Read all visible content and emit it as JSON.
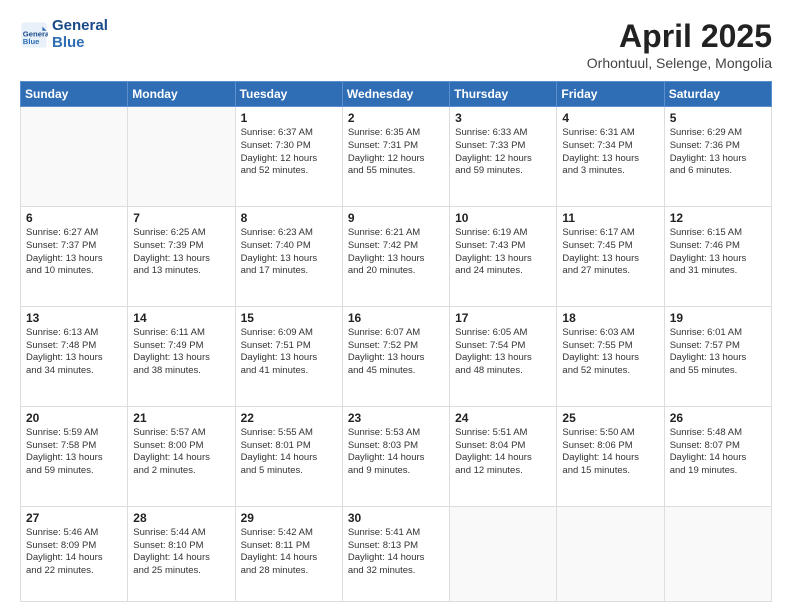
{
  "header": {
    "logo_line1": "General",
    "logo_line2": "Blue",
    "month": "April 2025",
    "location": "Orhontuul, Selenge, Mongolia"
  },
  "weekdays": [
    "Sunday",
    "Monday",
    "Tuesday",
    "Wednesday",
    "Thursday",
    "Friday",
    "Saturday"
  ],
  "weeks": [
    [
      {
        "day": "",
        "info": ""
      },
      {
        "day": "",
        "info": ""
      },
      {
        "day": "1",
        "info": "Sunrise: 6:37 AM\nSunset: 7:30 PM\nDaylight: 12 hours\nand 52 minutes."
      },
      {
        "day": "2",
        "info": "Sunrise: 6:35 AM\nSunset: 7:31 PM\nDaylight: 12 hours\nand 55 minutes."
      },
      {
        "day": "3",
        "info": "Sunrise: 6:33 AM\nSunset: 7:33 PM\nDaylight: 12 hours\nand 59 minutes."
      },
      {
        "day": "4",
        "info": "Sunrise: 6:31 AM\nSunset: 7:34 PM\nDaylight: 13 hours\nand 3 minutes."
      },
      {
        "day": "5",
        "info": "Sunrise: 6:29 AM\nSunset: 7:36 PM\nDaylight: 13 hours\nand 6 minutes."
      }
    ],
    [
      {
        "day": "6",
        "info": "Sunrise: 6:27 AM\nSunset: 7:37 PM\nDaylight: 13 hours\nand 10 minutes."
      },
      {
        "day": "7",
        "info": "Sunrise: 6:25 AM\nSunset: 7:39 PM\nDaylight: 13 hours\nand 13 minutes."
      },
      {
        "day": "8",
        "info": "Sunrise: 6:23 AM\nSunset: 7:40 PM\nDaylight: 13 hours\nand 17 minutes."
      },
      {
        "day": "9",
        "info": "Sunrise: 6:21 AM\nSunset: 7:42 PM\nDaylight: 13 hours\nand 20 minutes."
      },
      {
        "day": "10",
        "info": "Sunrise: 6:19 AM\nSunset: 7:43 PM\nDaylight: 13 hours\nand 24 minutes."
      },
      {
        "day": "11",
        "info": "Sunrise: 6:17 AM\nSunset: 7:45 PM\nDaylight: 13 hours\nand 27 minutes."
      },
      {
        "day": "12",
        "info": "Sunrise: 6:15 AM\nSunset: 7:46 PM\nDaylight: 13 hours\nand 31 minutes."
      }
    ],
    [
      {
        "day": "13",
        "info": "Sunrise: 6:13 AM\nSunset: 7:48 PM\nDaylight: 13 hours\nand 34 minutes."
      },
      {
        "day": "14",
        "info": "Sunrise: 6:11 AM\nSunset: 7:49 PM\nDaylight: 13 hours\nand 38 minutes."
      },
      {
        "day": "15",
        "info": "Sunrise: 6:09 AM\nSunset: 7:51 PM\nDaylight: 13 hours\nand 41 minutes."
      },
      {
        "day": "16",
        "info": "Sunrise: 6:07 AM\nSunset: 7:52 PM\nDaylight: 13 hours\nand 45 minutes."
      },
      {
        "day": "17",
        "info": "Sunrise: 6:05 AM\nSunset: 7:54 PM\nDaylight: 13 hours\nand 48 minutes."
      },
      {
        "day": "18",
        "info": "Sunrise: 6:03 AM\nSunset: 7:55 PM\nDaylight: 13 hours\nand 52 minutes."
      },
      {
        "day": "19",
        "info": "Sunrise: 6:01 AM\nSunset: 7:57 PM\nDaylight: 13 hours\nand 55 minutes."
      }
    ],
    [
      {
        "day": "20",
        "info": "Sunrise: 5:59 AM\nSunset: 7:58 PM\nDaylight: 13 hours\nand 59 minutes."
      },
      {
        "day": "21",
        "info": "Sunrise: 5:57 AM\nSunset: 8:00 PM\nDaylight: 14 hours\nand 2 minutes."
      },
      {
        "day": "22",
        "info": "Sunrise: 5:55 AM\nSunset: 8:01 PM\nDaylight: 14 hours\nand 5 minutes."
      },
      {
        "day": "23",
        "info": "Sunrise: 5:53 AM\nSunset: 8:03 PM\nDaylight: 14 hours\nand 9 minutes."
      },
      {
        "day": "24",
        "info": "Sunrise: 5:51 AM\nSunset: 8:04 PM\nDaylight: 14 hours\nand 12 minutes."
      },
      {
        "day": "25",
        "info": "Sunrise: 5:50 AM\nSunset: 8:06 PM\nDaylight: 14 hours\nand 15 minutes."
      },
      {
        "day": "26",
        "info": "Sunrise: 5:48 AM\nSunset: 8:07 PM\nDaylight: 14 hours\nand 19 minutes."
      }
    ],
    [
      {
        "day": "27",
        "info": "Sunrise: 5:46 AM\nSunset: 8:09 PM\nDaylight: 14 hours\nand 22 minutes."
      },
      {
        "day": "28",
        "info": "Sunrise: 5:44 AM\nSunset: 8:10 PM\nDaylight: 14 hours\nand 25 minutes."
      },
      {
        "day": "29",
        "info": "Sunrise: 5:42 AM\nSunset: 8:11 PM\nDaylight: 14 hours\nand 28 minutes."
      },
      {
        "day": "30",
        "info": "Sunrise: 5:41 AM\nSunset: 8:13 PM\nDaylight: 14 hours\nand 32 minutes."
      },
      {
        "day": "",
        "info": ""
      },
      {
        "day": "",
        "info": ""
      },
      {
        "day": "",
        "info": ""
      }
    ]
  ]
}
